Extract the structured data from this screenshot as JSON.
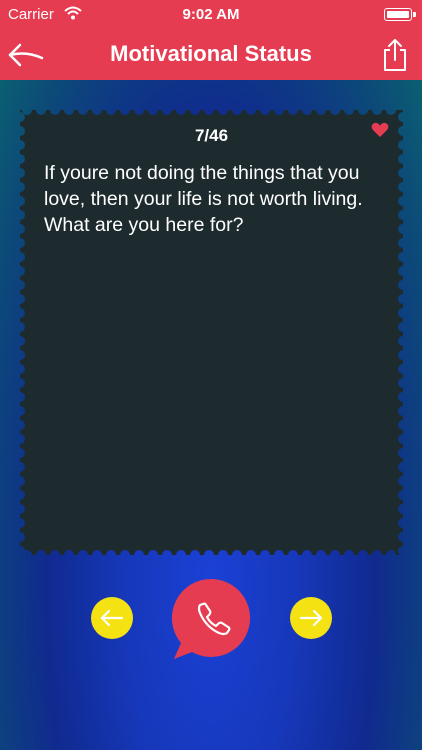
{
  "status_bar": {
    "carrier": "Carrier",
    "time": "9:02 AM"
  },
  "nav": {
    "title": "Motivational Status",
    "back_icon": "back-arrow-icon",
    "share_icon": "share-icon"
  },
  "card": {
    "counter": "7/46",
    "quote": "If youre not doing the things that you love, then your life is not worth living. What are you here for?",
    "favorite_icon": "heart-icon"
  },
  "controls": {
    "prev_icon": "arrow-left-icon",
    "call_icon": "phone-bubble-icon",
    "next_icon": "arrow-right-icon"
  },
  "colors": {
    "accent": "#e63c52",
    "card": "#1d2b2f",
    "arrow_buttons": "#f4e213",
    "heart": "#e63c52"
  }
}
